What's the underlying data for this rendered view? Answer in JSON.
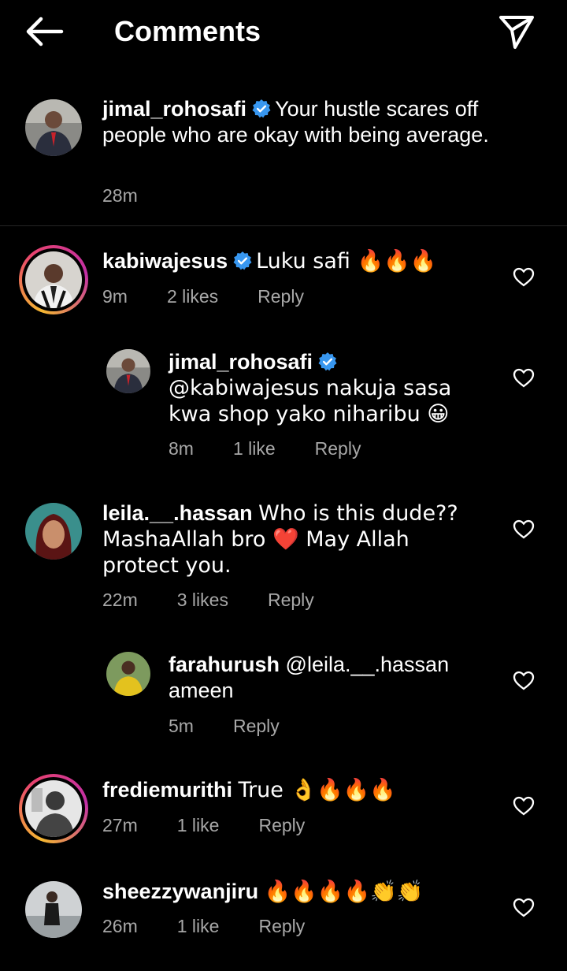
{
  "header": {
    "title": "Comments"
  },
  "caption": {
    "username": "jimal_rohosafi",
    "text": "Your hustle scares off people who are okay with being average.",
    "time": "28m"
  },
  "comments": [
    {
      "username": "kabiwajesus",
      "verified": true,
      "text": "Luku safi 🔥🔥🔥",
      "time": "9m",
      "likes": "2 likes",
      "reply": "Reply"
    },
    {
      "username": "jimal_rohosafi",
      "verified": true,
      "text": "@kabiwajesus nakuja sasa kwa shop yako niharibu 😀",
      "time": "8m",
      "likes": "1 like",
      "reply": "Reply"
    },
    {
      "username": "leila.__.hassan",
      "verified": false,
      "text": "Who is this dude?? MashaAllah bro ❤️ May Allah protect you.",
      "time": "22m",
      "likes": "3 likes",
      "reply": "Reply"
    },
    {
      "username": "farahurush",
      "verified": false,
      "text": "@leila.__.hassan ameen",
      "time": "5m",
      "likes": "",
      "reply": "Reply"
    },
    {
      "username": "frediemurithi",
      "verified": false,
      "text": "True 👌🔥🔥🔥",
      "time": "27m",
      "likes": "1 like",
      "reply": "Reply"
    },
    {
      "username": "sheezzywanjiru",
      "verified": false,
      "text": "🔥🔥🔥🔥👏👏",
      "time": "26m",
      "likes": "1 like",
      "reply": "Reply"
    }
  ],
  "colors": {
    "background": "#000000",
    "text": "#ffffff",
    "meta": "#a8a8a8",
    "verified": "#3897f0",
    "divider": "#262626"
  }
}
